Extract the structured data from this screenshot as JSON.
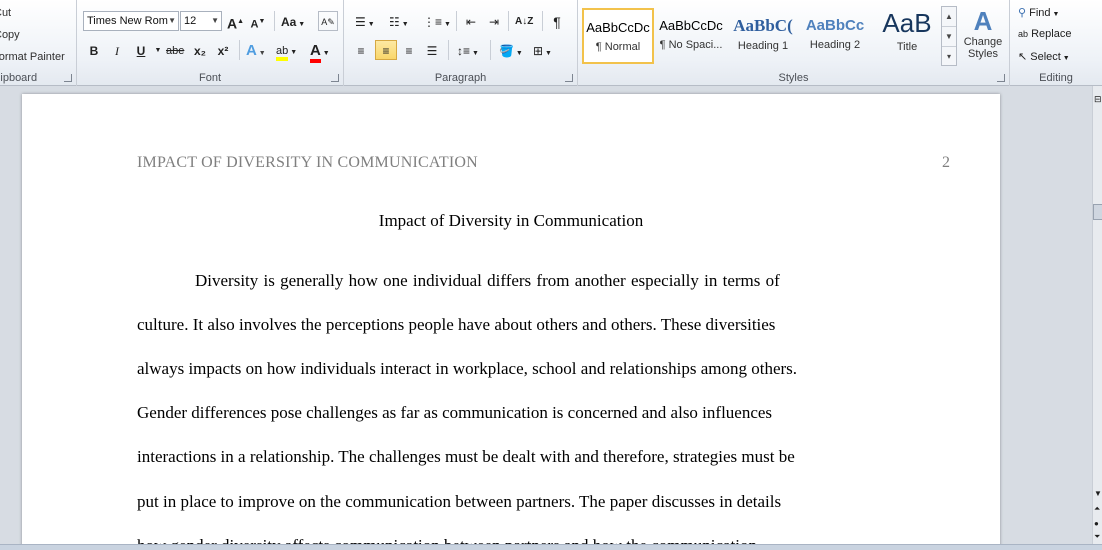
{
  "clipboard": {
    "cut": "Cut",
    "copy": "Copy",
    "format_painter": "Format Painter",
    "label": "Clipboard"
  },
  "font": {
    "name": "Times New Rom",
    "size": "12",
    "grow": "A",
    "shrink": "A",
    "change_case": "Aa",
    "bold": "B",
    "italic": "I",
    "underline": "U",
    "strike": "abe",
    "subscript": "x₂",
    "superscript": "x²",
    "effects": "A",
    "highlight": "ab",
    "font_color": "A",
    "label": "Font"
  },
  "paragraph": {
    "pilcrow": "¶",
    "label": "Paragraph"
  },
  "styles": {
    "items": [
      {
        "sample": "AaBbCcDc",
        "name": "¶ Normal"
      },
      {
        "sample": "AaBbCcDc",
        "name": "¶ No Spaci..."
      },
      {
        "sample": "AaBbC(",
        "name": "Heading 1"
      },
      {
        "sample": "AaBbCc",
        "name": "Heading 2"
      },
      {
        "sample": "AaB",
        "name": "Title"
      }
    ],
    "change_styles": "Change Styles",
    "change_icon_letter": "A",
    "label": "Styles"
  },
  "editing": {
    "find": "Find",
    "replace": "Replace",
    "select": "Select",
    "label": "Editing"
  },
  "document": {
    "header": "IMPACT OF DIVERSITY IN COMMUNICATION",
    "page_number": "2",
    "title": "Impact of Diversity in Communication",
    "lines": [
      "Diversity is generally how one individual differs from another especially in terms of",
      "culture. It also involves the perceptions people have about others and others. These diversities",
      "always impacts on how individuals interact in workplace, school and relationships among others.",
      "Gender differences pose challenges as far as communication is concerned and also influences",
      "interactions in a relationship. The challenges must be dealt with and therefore, strategies must be",
      "put in place to improve on the communication between partners. The paper discusses in details",
      "how gender diversity affects communication between partners and how the communication"
    ]
  },
  "colors": {
    "accent": "#f2c24b",
    "highlight": "#ffff00",
    "font_color": "#ff0000",
    "header_gray": "#7f7f7f"
  }
}
